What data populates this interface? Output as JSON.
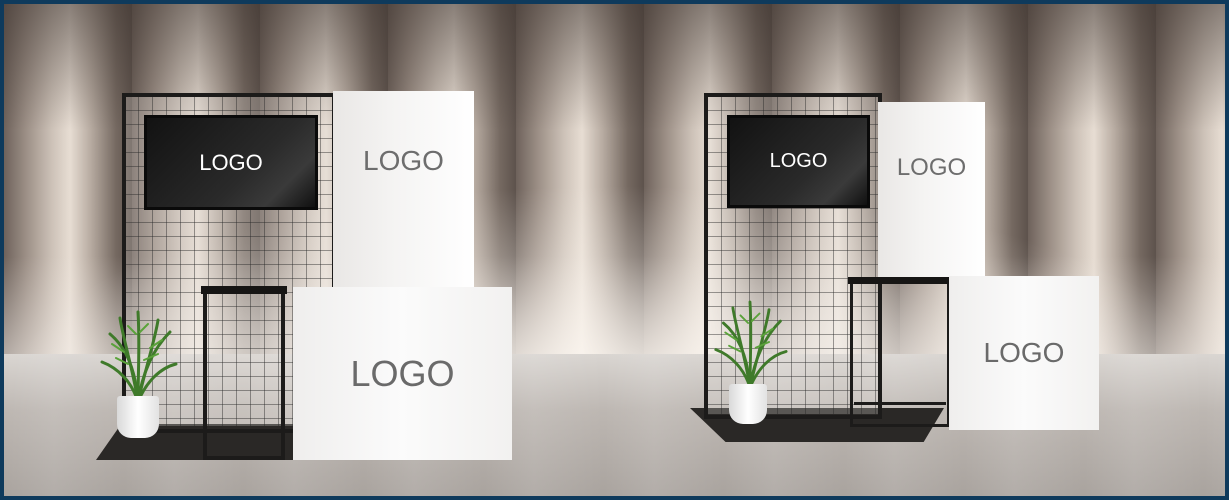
{
  "scene": {
    "description_visible_text": [
      "LOGO"
    ],
    "booth_left": {
      "tv_logo": "LOGO",
      "tall_panel_logo": "LOGO",
      "counter_logo": "LOGO"
    },
    "booth_right": {
      "tv_logo": "LOGO",
      "tall_panel_logo": "LOGO",
      "counter_logo": "LOGO"
    }
  },
  "colors": {
    "border": "#0e3a5c",
    "wall": "#cbc3bb",
    "black_frame": "#1c1b1a",
    "white_panel": "#f4f3f2",
    "logo_text_on_white": "#6d6d6d",
    "logo_text_on_tv": "#ffffff"
  },
  "icons": [
    "plant-icon"
  ]
}
